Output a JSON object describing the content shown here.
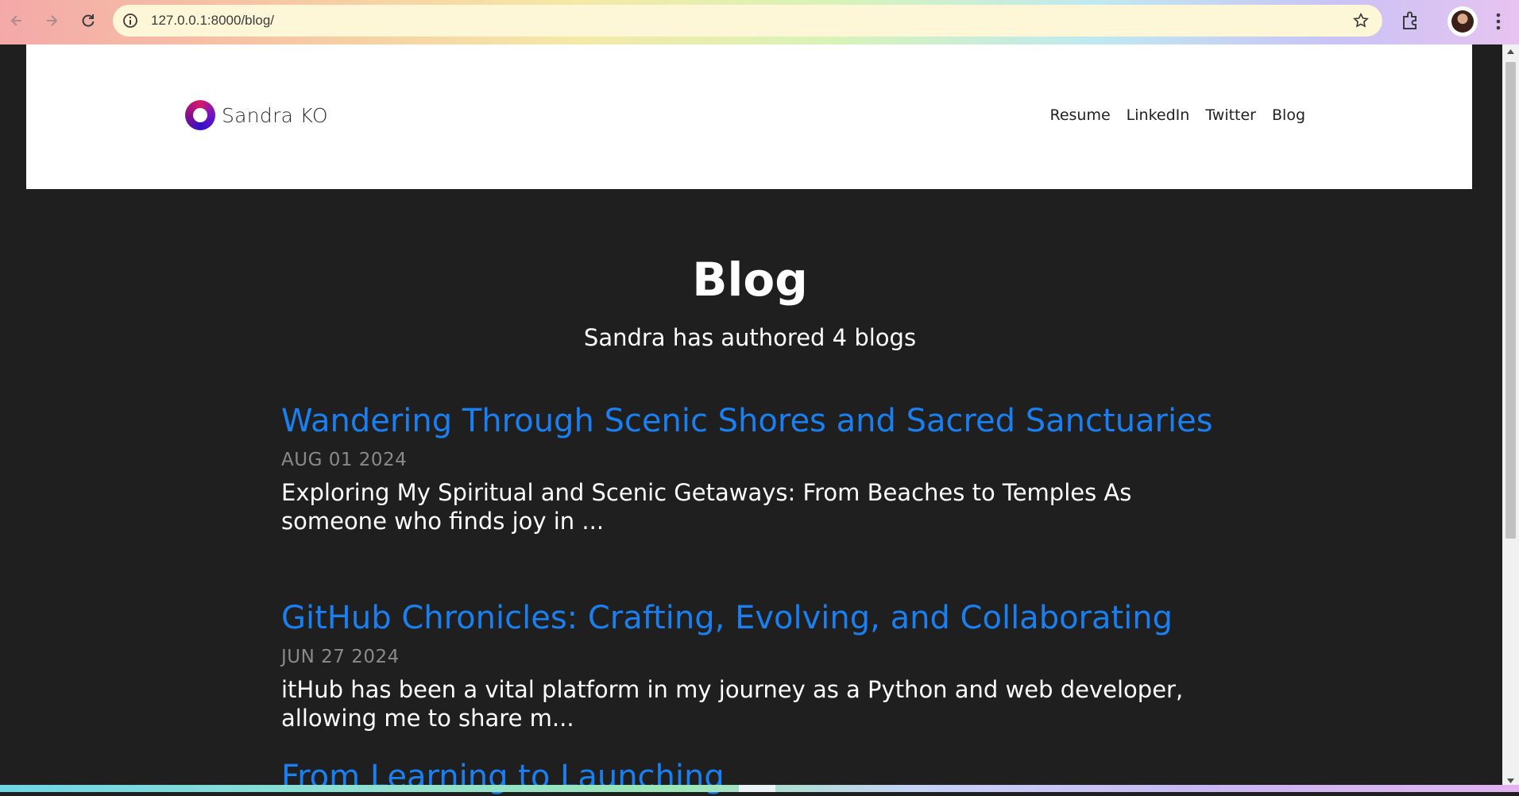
{
  "browser": {
    "url": "127.0.0.1:8000/blog/",
    "icons": [
      "back-icon",
      "forward-icon",
      "reload-icon",
      "site-info-icon",
      "bookmark-star-icon",
      "extensions-icon",
      "profile-avatar",
      "menu-icon"
    ]
  },
  "site": {
    "brand": "Sandra KO",
    "nav": [
      "Resume",
      "LinkedIn",
      "Twitter",
      "Blog"
    ]
  },
  "page": {
    "title": "Blog",
    "subtitle": "Sandra has authored 4 blogs",
    "posts": [
      {
        "title": "Wandering Through Scenic Shores and Sacred Sanctuaries",
        "date": "AUG 01 2024",
        "excerpt": "Exploring My Spiritual and Scenic Getaways: From Beaches to Temples As someone who finds joy in ..."
      },
      {
        "title": "GitHub Chronicles: Crafting, Evolving, and Collaborating",
        "date": "JUN 27 2024",
        "excerpt": "itHub has been a vital platform in my journey as a Python and web developer, allowing me to share m..."
      },
      {
        "title": "From Learning to Launching"
      }
    ]
  },
  "colors": {
    "page_bg": "#1f1f1f",
    "header_bg": "#ffffff",
    "link": "#1a7ff0",
    "date": "#8a8a8a"
  }
}
